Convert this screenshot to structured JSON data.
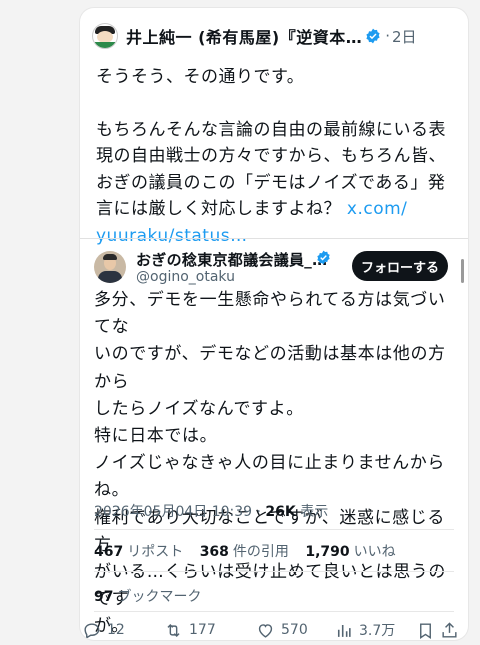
{
  "quote": {
    "author_name": "井上純一 (希有馬屋)『逆資本…",
    "separator": "·",
    "time": "2日",
    "paragraph1": "そうそう、その通りです。",
    "paragraph2_lines": [
      "もちろんそんな言論の自由の最前線にいる表",
      "現の自由戦士の方々ですから、もちろん皆、",
      "おぎの議員のこの「デモはノイズである」発",
      "言には厳しく対応しますよね？ "
    ],
    "link_part1": "x.com/",
    "link_part2": "yuuraku/status…"
  },
  "embedded": {
    "author_name": "おぎの稔東京都議会議員_…",
    "handle": "@ogino_otaku",
    "follow_label": "フォローする",
    "lines": [
      "多分、デモを一生懸命やられてる方は気づいてな",
      "いのですが、デモなどの活動は基本は他の方から",
      "したらノイズなんですよ。",
      "特に日本では。",
      "ノイズじゃなきゃ人の目に止まりませんからね。",
      "権利であり大切なことですが、迷惑に感じる方",
      "がいる…くらいは受け止めて良いとは思うのです",
      "が。"
    ],
    "datetime": "2026年05月04日 10:39",
    "dot": "·",
    "views": "26K",
    "views_label": "表示",
    "reposts": "467",
    "reposts_label": "リポスト",
    "quotes": "368",
    "quotes_label": "件の引用",
    "likes": "1,790",
    "likes_label": "いいね",
    "bookmarks": "97",
    "bookmarks_label": "ブックマーク",
    "actions": {
      "reply_count": "12",
      "repost_count": "177",
      "like_count": "570",
      "views_count": "3.7万"
    }
  },
  "colors": {
    "link": "#1d9bf0",
    "verified": "#1d9bf0",
    "follow_bg": "#0f1419"
  }
}
